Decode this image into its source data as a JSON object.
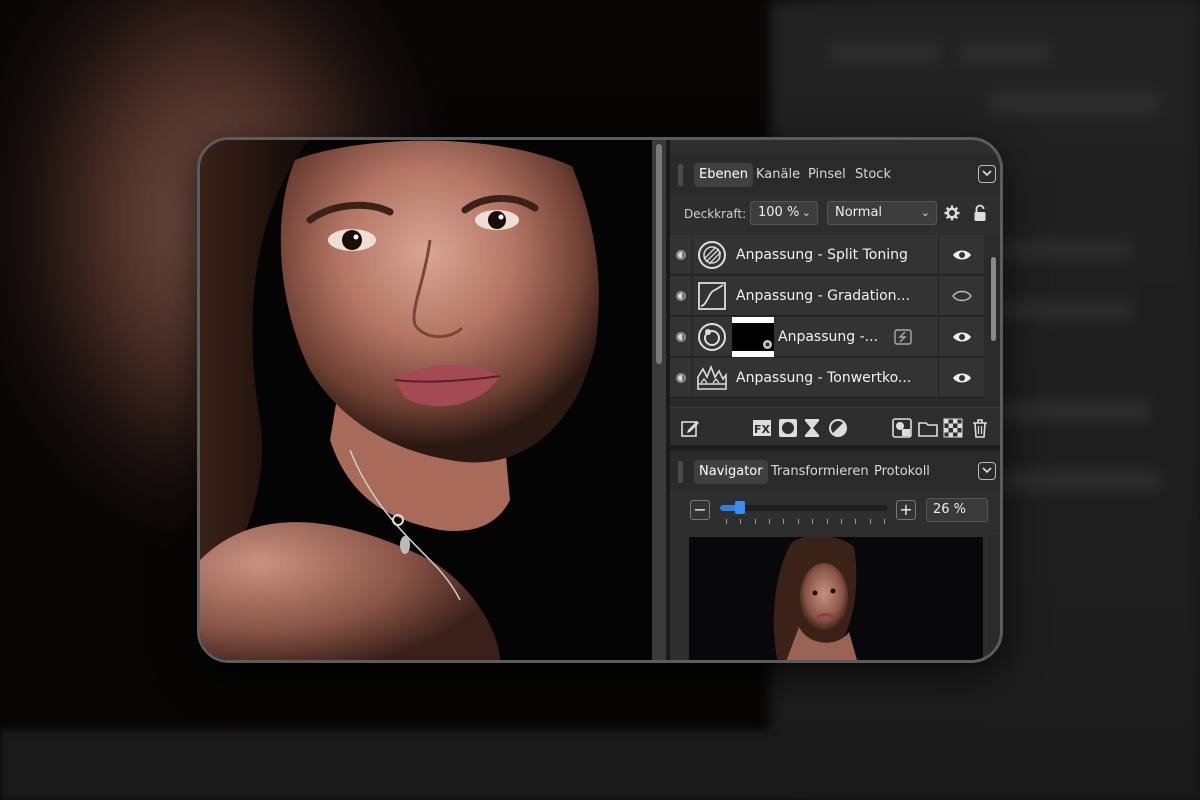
{
  "layers_panel": {
    "tabs": [
      {
        "label": "Ebenen",
        "active": true
      },
      {
        "label": "Kanäle",
        "active": false
      },
      {
        "label": "Pinsel",
        "active": false
      },
      {
        "label": "Stock",
        "active": false
      }
    ],
    "opacity_label": "Deckkraft:",
    "opacity_value": "100 %",
    "blend_mode": "Normal",
    "layers": [
      {
        "name": "Anpassung - Split Toning",
        "icon": "split-toning-icon",
        "visible": true
      },
      {
        "name": "Anpassung - Gradation...",
        "icon": "curves-icon",
        "visible": false
      },
      {
        "name": "Anpassung -...",
        "icon": "color-balance-icon",
        "visible": true,
        "has_mask": true
      },
      {
        "name": "Anpassung - Tonwertko...",
        "icon": "levels-icon",
        "visible": true
      }
    ]
  },
  "navigator_panel": {
    "tabs": [
      {
        "label": "Navigator",
        "active": true
      },
      {
        "label": "Transformieren",
        "active": false
      },
      {
        "label": "Protokoll",
        "active": false
      }
    ],
    "zoom_minus": "−",
    "zoom_plus": "+",
    "zoom_value": "26 %",
    "zoom_level": 0.12
  },
  "colors": {
    "accent": "#2f7fe0",
    "panel_bg": "#2e2e2e"
  }
}
